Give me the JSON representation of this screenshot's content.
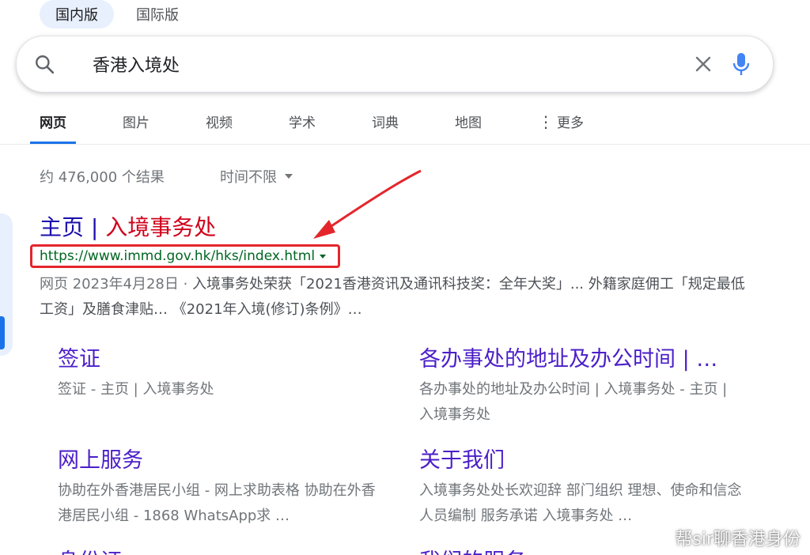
{
  "region_tabs": [
    {
      "label": "国内版",
      "active": true
    },
    {
      "label": "国际版",
      "active": false
    }
  ],
  "search": {
    "query": "香港入境处"
  },
  "nav_tabs": [
    {
      "label": "网页",
      "active": true
    },
    {
      "label": "图片"
    },
    {
      "label": "视频"
    },
    {
      "label": "学术"
    },
    {
      "label": "词典"
    },
    {
      "label": "地图"
    },
    {
      "label": "更多"
    }
  ],
  "results_info": {
    "count": "约 476,000 个结果",
    "time_filter": "时间不限"
  },
  "result": {
    "title_prefix": "主页 |",
    "title_highlight": " 入境事务处",
    "url": "https://www.immd.gov.hk/hks/index.html",
    "snippet_meta": "网页 2023年4月28日 · ",
    "snippet_text": "入境事务处荣获「2021香港资讯及通讯科技奖：全年大奖」... 外籍家庭佣工「规定最低工资」及膳食津贴… 《2021年入境(修订)条例》…"
  },
  "sitelinks": [
    {
      "title": "签证",
      "desc": "签证 - 主页 | 入境事务处"
    },
    {
      "title": "各办事处的地址及办公时间 | …",
      "desc": "各办事处的地址及办公时间 | 入境事务处 - 主页 | 入境事务处"
    },
    {
      "title": "网上服务",
      "desc": "协助在外香港居民小组 - 网上求助表格 协助在外香港居民小组 - 1868 WhatsApp求 …"
    },
    {
      "title": "关于我们",
      "desc": "入境事务处处长欢迎辞 部门组织 理想、使命和信念 人员编制 服务承诺 入境事务处 …"
    },
    {
      "title": "身份证",
      "desc": ""
    },
    {
      "title": "我们的服务",
      "desc": ""
    }
  ],
  "watermark": {
    "text": "帮sir聊香港身份"
  },
  "colors": {
    "link": "#1a0dab",
    "url_green": "#006621",
    "highlight_red": "#d0021b",
    "annotation_red": "#e4262c",
    "tab_underline": "#1a73e8"
  }
}
